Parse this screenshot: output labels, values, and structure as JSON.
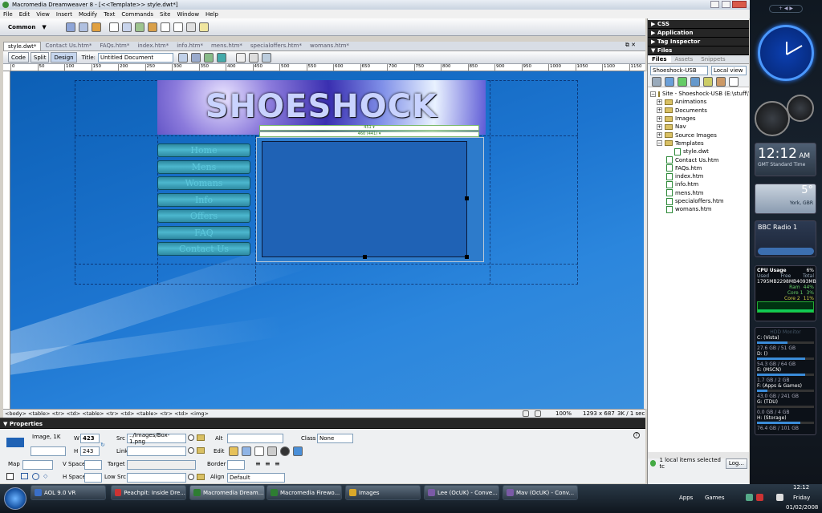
{
  "window": {
    "title": "Macromedia Dreamweaver 8 - [<<Template>> style.dwt*]"
  },
  "menu": [
    "File",
    "Edit",
    "View",
    "Insert",
    "Modify",
    "Text",
    "Commands",
    "Site",
    "Window",
    "Help"
  ],
  "insert_bar": {
    "category": "Common"
  },
  "doc_tabs": [
    "style.dwt*",
    "Contact Us.htm*",
    "FAQs.htm*",
    "index.htm*",
    "info.htm*",
    "mens.htm*",
    "specialoffers.htm*",
    "womans.htm*"
  ],
  "doc_toolbar": {
    "code": "Code",
    "split": "Split",
    "design": "Design",
    "title_label": "Title:",
    "title_value": "Untitled Document"
  },
  "ruler": [
    "0",
    "50",
    "100",
    "150",
    "200",
    "250",
    "300",
    "350",
    "400",
    "450",
    "500",
    "550",
    "600",
    "650",
    "700",
    "750",
    "800",
    "850",
    "900",
    "950",
    "1000",
    "1050",
    "1100",
    "1150"
  ],
  "page": {
    "logo": "SHOESHOCK",
    "width_tag1": "451 ▾",
    "width_tag2": "460 (441) ▾",
    "nav": [
      "Home",
      "Mens",
      "Womans",
      "Info",
      "Offers",
      "FAQ",
      "Contact Us"
    ]
  },
  "status": {
    "tags": "<body> <table> <tr> <td> <table> <tr> <td> <table> <tr> <td> <img>",
    "zoom": "100%",
    "size": "1293 x 687",
    "kb": "3K / 1 sec"
  },
  "properties": {
    "title": "Properties",
    "type": "Image, 1K",
    "w_label": "W",
    "w": "423",
    "h_label": "H",
    "h": "243",
    "src_label": "Src",
    "src": "../Images/Box-1.png",
    "link_label": "Link",
    "link": "",
    "alt_label": "Alt",
    "alt": "",
    "edit_label": "Edit",
    "class_label": "Class",
    "class": "None",
    "map_label": "Map",
    "vspace_label": "V Space",
    "target_label": "Target",
    "border_label": "Border",
    "hspace_label": "H Space",
    "lowsrc_label": "Low Src",
    "align_label": "Align",
    "align": "Default"
  },
  "panels": {
    "css": "CSS",
    "application": "Application",
    "tag_inspector": "Tag Inspector",
    "files": "Files"
  },
  "files_panel": {
    "tabs": [
      "Files",
      "Assets",
      "Snippets"
    ],
    "site": "Shoeshock-USB",
    "view": "Local view",
    "root": "Site - Shoeshock-USB (E:\\stuff\\W",
    "folders": [
      "Animations",
      "Documents",
      "Images",
      "Nav",
      "Source Images",
      "Templates"
    ],
    "template_file": "style.dwt",
    "files": [
      "Contact Us.htm",
      "FAQs.htm",
      "index.htm",
      "info.htm",
      "mens.htm",
      "specialoffers.htm",
      "womans.htm"
    ],
    "footer": "1 local items selected tc",
    "log": "Log..."
  },
  "sidebar": {
    "time": "12:12",
    "ampm": "AM",
    "tz": "GMT Standard Time",
    "temp": "5°",
    "city": "York, GBR",
    "radio": "BBC Radio 1",
    "cpu": {
      "title": "CPU Usage",
      "pct": "6%",
      "used_label": "Used",
      "free_label": "Free",
      "total_label": "Total",
      "used": "1795MB",
      "free": "2298MB",
      "total": "4093MB",
      "ram_label": "Ram",
      "ram": "44%",
      "core1_label": "Core 1",
      "core1": "3%",
      "core2_label": "Core 2",
      "core2": "11%"
    },
    "hdd_title": "HDD Monitor",
    "drives": [
      {
        "name": "C: (Vista)",
        "size": "27.6 GB / 51 GB",
        "fill": 0.54
      },
      {
        "name": "D: ()",
        "size": "54.3 GB / 64 GB",
        "fill": 0.85
      },
      {
        "name": "E: (MSCN)",
        "size": "1.7 GB / 2 GB",
        "fill": 0.85
      },
      {
        "name": "F: (Apps & Games)",
        "size": "43.0 GB / 241 GB",
        "fill": 0.18
      },
      {
        "name": "G: (TDU)",
        "size": "0.0 GB / 4 GB",
        "fill": 0.0
      },
      {
        "name": "H: (Storage)",
        "size": "76.4 GB / 101 GB",
        "fill": 0.76
      }
    ]
  },
  "taskbar": {
    "items": [
      "AOL 9.0 VR",
      "Peachpit: Inside Dre...",
      "Macromedia Dream...",
      "Macromedia Firewo...",
      "Images",
      "Lee (OcUK) - Conve...",
      "Mav (OcUK) - Conv..."
    ],
    "apps": "Apps",
    "games": "Games",
    "clock": "12:12",
    "day": "Friday",
    "date": "01/02/2008"
  },
  "colors": {
    "canvas": "#1a6fc6",
    "accent": "#3b8cd9",
    "nav": "#3aa6bf",
    "taskbar": "#1c2733"
  }
}
